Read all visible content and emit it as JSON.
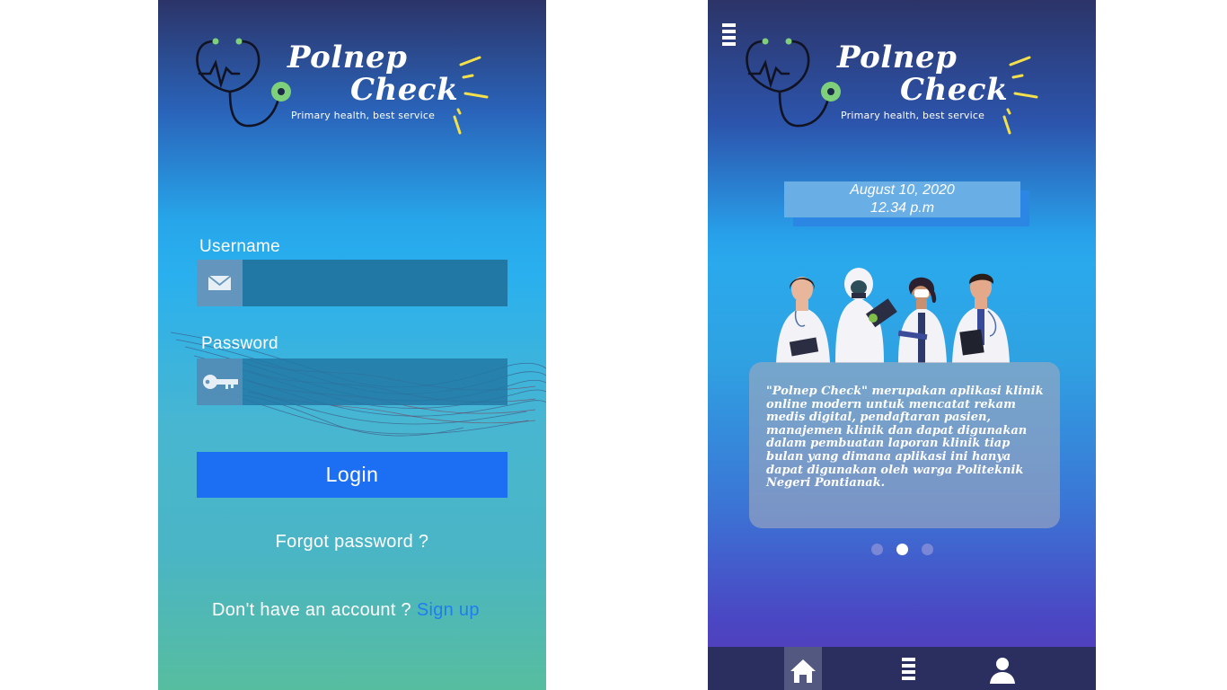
{
  "brand": {
    "name_line1": "Polnep",
    "name_line2": "Check",
    "tagline": "Primary health, best service"
  },
  "login": {
    "username_label": "Username",
    "username_value": "",
    "password_label": "Password",
    "password_value": "",
    "login_button": "Login",
    "forgot_password": "Forgot password ?",
    "no_account_text": "Don't have an account ?",
    "signup_link": "Sign up",
    "icons": {
      "username": "mail-icon",
      "password": "key-icon"
    }
  },
  "home": {
    "date": "August 10, 2020",
    "time": "12.34 p.m",
    "description": "\"Polnep Check\" merupakan aplikasi klinik online modern untuk mencatat rekam medis digital, pendaftaran pasien, manajemen klinik dan dapat digunakan dalam pembuatan laporan klinik tiap bulan yang dimana aplikasi ini hanya dapat digunakan oleh warga Politeknik Negeri Pontianak.",
    "carousel": {
      "count": 3,
      "active_index": 1
    },
    "nav": [
      {
        "icon": "home-icon",
        "active": true
      },
      {
        "icon": "list-icon",
        "active": false
      },
      {
        "icon": "user-icon",
        "active": false
      }
    ],
    "menu_icon": "hamburger-menu-icon"
  },
  "colors": {
    "login_button": "#1c6ef2",
    "signup_link": "#1e7ef0",
    "input_background": "#2278a4",
    "navbar": "#2a2f5f",
    "accent_yellow": "#f3e04a",
    "stethoscope_green": "#7fd07a"
  }
}
